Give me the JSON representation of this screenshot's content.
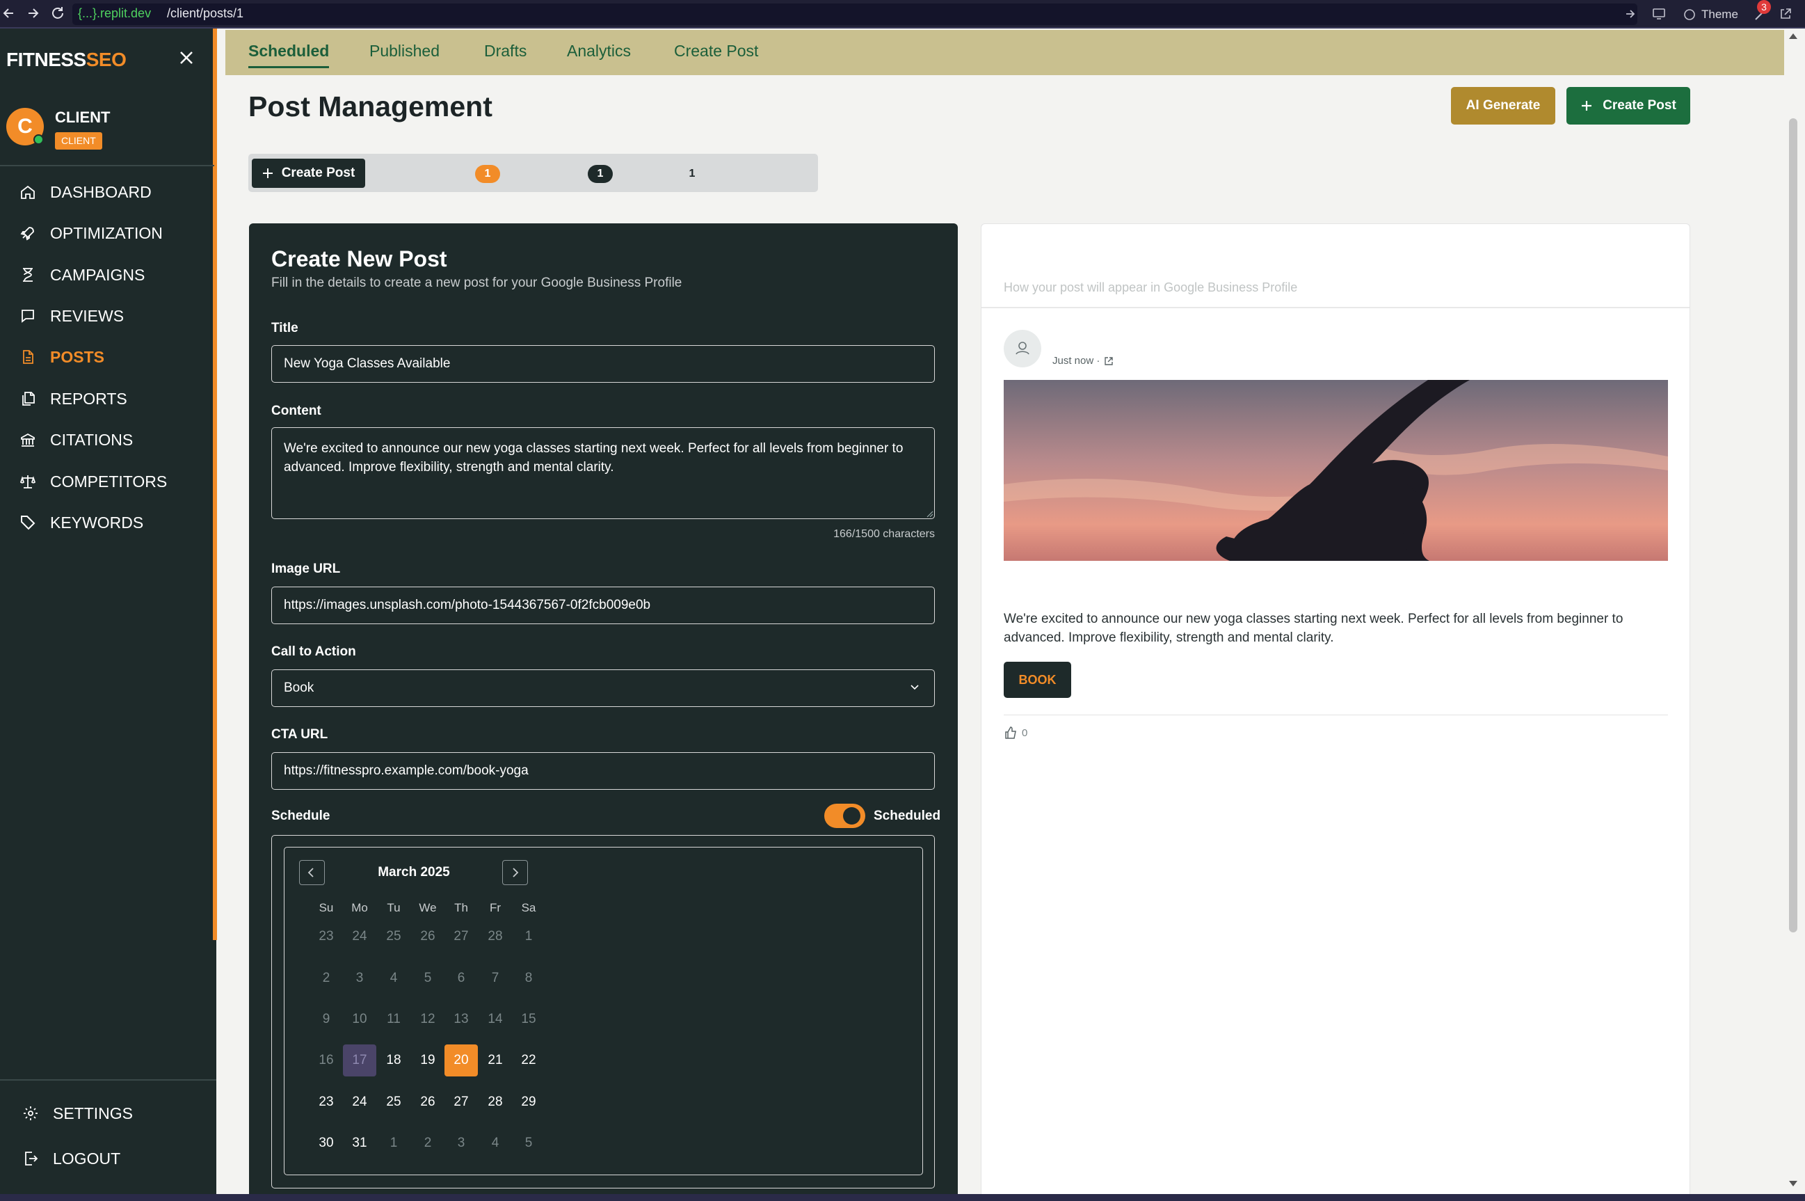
{
  "browser": {
    "url_host": "{...}.replit.dev",
    "url_path": "/client/posts/1",
    "theme_label": "Theme",
    "notification_count": "3"
  },
  "sidebar": {
    "logo_part1": "FITNESS",
    "logo_part2": "SEO",
    "user": {
      "initial": "C",
      "name": "CLIENT",
      "role": "CLIENT"
    },
    "items": [
      {
        "label": "DASHBOARD",
        "icon": "home-icon"
      },
      {
        "label": "OPTIMIZATION",
        "icon": "rocket-icon"
      },
      {
        "label": "CAMPAIGNS",
        "icon": "hourglass-icon"
      },
      {
        "label": "REVIEWS",
        "icon": "message-icon"
      },
      {
        "label": "POSTS",
        "icon": "document-icon",
        "active": true
      },
      {
        "label": "REPORTS",
        "icon": "copy-icon"
      },
      {
        "label": "CITATIONS",
        "icon": "building-icon"
      },
      {
        "label": "COMPETITORS",
        "icon": "scale-icon"
      },
      {
        "label": "KEYWORDS",
        "icon": "tag-icon"
      }
    ],
    "bottom_items": [
      {
        "label": "SETTINGS",
        "icon": "gear-icon"
      },
      {
        "label": "LOGOUT",
        "icon": "logout-icon"
      }
    ]
  },
  "tabs": [
    {
      "label": "Scheduled",
      "active": true
    },
    {
      "label": "Published"
    },
    {
      "label": "Drafts"
    },
    {
      "label": "Analytics"
    },
    {
      "label": "Create Post"
    }
  ],
  "header": {
    "title": "Post Management",
    "ai_generate_label": "AI Generate",
    "create_post_label": "Create Post"
  },
  "subtabs": {
    "create_label": "Create Post",
    "counts": [
      "1",
      "1",
      "1"
    ]
  },
  "form": {
    "title": "Create New Post",
    "subtitle": "Fill in the details to create a new post for your Google Business Profile",
    "title_label": "Title",
    "title_value": "New Yoga Classes Available",
    "content_label": "Content",
    "content_value": "We're excited to announce our new yoga classes starting next week. Perfect for all levels from beginner to advanced. Improve flexibility, strength and mental clarity.",
    "char_count": "166/1500 characters",
    "image_url_label": "Image URL",
    "image_url_value": "https://images.unsplash.com/photo-1544367567-0f2fcb009e0b",
    "cta_label": "Call to Action",
    "cta_value": "Book",
    "cta_url_label": "CTA URL",
    "cta_url_value": "https://fitnesspro.example.com/book-yoga",
    "schedule_label": "Schedule",
    "schedule_toggle_label": "Scheduled",
    "schedule_enabled": true
  },
  "calendar": {
    "month": "March 2025",
    "weekdays": [
      "Su",
      "Mo",
      "Tu",
      "We",
      "Th",
      "Fr",
      "Sa"
    ],
    "weeks": [
      [
        {
          "d": "23",
          "m": 1
        },
        {
          "d": "24",
          "m": 1
        },
        {
          "d": "25",
          "m": 1
        },
        {
          "d": "26",
          "m": 1
        },
        {
          "d": "27",
          "m": 1
        },
        {
          "d": "28",
          "m": 1
        },
        {
          "d": "1",
          "m": 1
        }
      ],
      [
        {
          "d": "2",
          "m": 1
        },
        {
          "d": "3",
          "m": 1
        },
        {
          "d": "4",
          "m": 1
        },
        {
          "d": "5",
          "m": 1
        },
        {
          "d": "6",
          "m": 1
        },
        {
          "d": "7",
          "m": 1
        },
        {
          "d": "8",
          "m": 1
        }
      ],
      [
        {
          "d": "9",
          "m": 1
        },
        {
          "d": "10",
          "m": 1
        },
        {
          "d": "11",
          "m": 1
        },
        {
          "d": "12",
          "m": 1
        },
        {
          "d": "13",
          "m": 1
        },
        {
          "d": "14",
          "m": 1
        },
        {
          "d": "15",
          "m": 1
        }
      ],
      [
        {
          "d": "16",
          "m": 1
        },
        {
          "d": "17",
          "t": 1
        },
        {
          "d": "18"
        },
        {
          "d": "19"
        },
        {
          "d": "20",
          "s": 1
        },
        {
          "d": "21"
        },
        {
          "d": "22"
        }
      ],
      [
        {
          "d": "23"
        },
        {
          "d": "24"
        },
        {
          "d": "25"
        },
        {
          "d": "26"
        },
        {
          "d": "27"
        },
        {
          "d": "28"
        },
        {
          "d": "29"
        }
      ],
      [
        {
          "d": "30"
        },
        {
          "d": "31"
        },
        {
          "d": "1",
          "m": 1
        },
        {
          "d": "2",
          "m": 1
        },
        {
          "d": "3",
          "m": 1
        },
        {
          "d": "4",
          "m": 1
        },
        {
          "d": "5",
          "m": 1
        }
      ]
    ],
    "today": "17",
    "selected": "20"
  },
  "preview": {
    "subtitle": "How your post will appear in Google Business Profile",
    "time": "Just now ·",
    "text": "We're excited to announce our new yoga classes starting next week. Perfect for all levels from beginner to advanced. Improve flexibility, strength and mental clarity.",
    "cta_label": "BOOK",
    "likes": "0"
  },
  "colors": {
    "sidebar_bg": "#1e2a2a",
    "accent_orange": "#f28c28",
    "tabbar_bg": "#c9c08f",
    "brand_green": "#1c6e3e",
    "ai_gold": "#b08a2e"
  }
}
